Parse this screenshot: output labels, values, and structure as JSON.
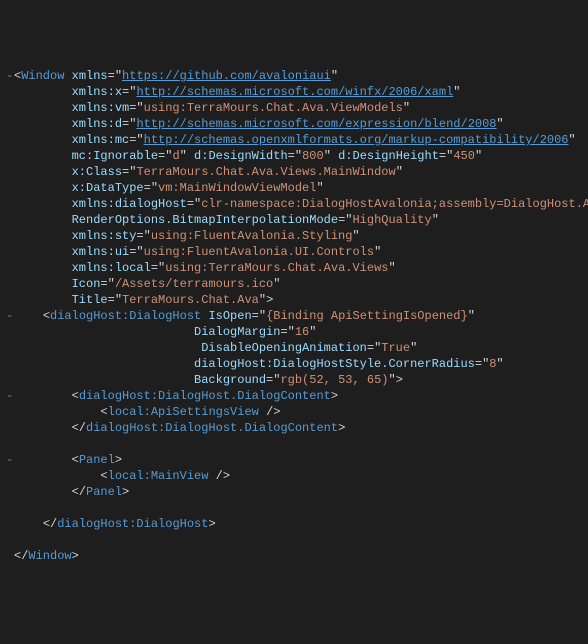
{
  "gutter": {
    "collapse": "-"
  },
  "code": {
    "tag_window": "Window",
    "tag_dialoghost": "dialogHost:DialogHost",
    "tag_dialogcontent": "dialogHost:DialogHost.DialogContent",
    "tag_apisettings": "local:ApiSettingsView",
    "tag_panel": "Panel",
    "tag_mainview": "local:MainView",
    "attrs": {
      "xmlns": "xmlns",
      "xmlns_x": "xmlns:x",
      "xmlns_vm": "xmlns:vm",
      "xmlns_d": "xmlns:d",
      "xmlns_mc": "xmlns:mc",
      "mc_ignorable": "mc:Ignorable",
      "d_designwidth": "d:DesignWidth",
      "d_designheight": "d:DesignHeight",
      "x_class": "x:Class",
      "x_datatype": "x:DataType",
      "xmlns_dialoghost": "xmlns:dialogHost",
      "renderoptions": "RenderOptions.BitmapInterpolationMode",
      "xmlns_sty": "xmlns:sty",
      "xmlns_ui": "xmlns:ui",
      "xmlns_local": "xmlns:local",
      "icon": "Icon",
      "title": "Title",
      "isopen": "IsOpen",
      "dialogmargin": "DialogMargin",
      "disableopening": "DisableOpeningAnimation",
      "cornerradius": "dialogHost:DialogHostStyle.CornerRadius",
      "background": "Background"
    },
    "vals": {
      "xmlns": "https://github.com/avaloniaui",
      "xmlns_x": "http://schemas.microsoft.com/winfx/2006/xaml",
      "xmlns_vm": "using:TerraMours.Chat.Ava.ViewModels",
      "xmlns_d": "http://schemas.microsoft.com/expression/blend/2008",
      "xmlns_mc": "http://schemas.openxmlformats.org/markup-compatibility/2006",
      "mc_ignorable": "d",
      "d_designwidth": "800",
      "d_designheight": "450",
      "x_class": "TerraMours.Chat.Ava.Views.MainWindow",
      "x_datatype": "vm:MainWindowViewModel",
      "xmlns_dialoghost": "clr-namespace:DialogHostAvalonia;assembly=DialogHost.Avalonia",
      "renderoptions": "HighQuality",
      "xmlns_sty": "using:FluentAvalonia.Styling",
      "xmlns_ui": "using:FluentAvalonia.UI.Controls",
      "xmlns_local": "using:TerraMours.Chat.Ava.Views",
      "icon": "/Assets/terramours.ico",
      "title": "TerraMours.Chat.Ava",
      "isopen": "{Binding ApiSettingIsOpened}",
      "dialogmargin": "16",
      "disableopening": "True",
      "cornerradius": "8",
      "background": "rgb(52, 53, 65)"
    }
  }
}
